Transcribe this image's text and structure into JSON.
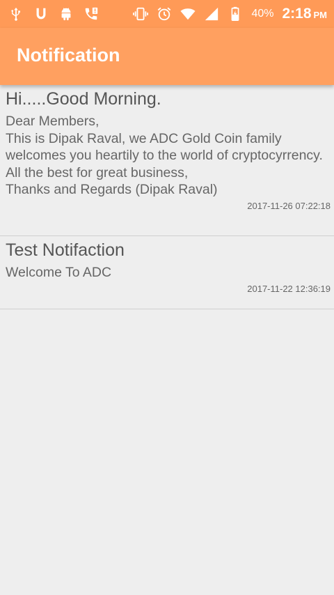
{
  "status_bar": {
    "icons_left": [
      "usb-icon",
      "u-app-icon",
      "android-icon",
      "missed-call-icon"
    ],
    "icons_right": [
      "vibrate-icon",
      "alarm-icon",
      "wifi-icon",
      "cell-signal-icon",
      "battery-charging-icon"
    ],
    "battery": "40%",
    "time": "2:18",
    "ampm": "PM"
  },
  "appbar": {
    "title": "Notification"
  },
  "notifications": [
    {
      "title": "Hi.....Good Morning.",
      "body": "Dear Members,\nThis is Dipak Raval, we ADC Gold Coin family welcomes you heartily to the world of cryptocyrrency.\nAll the best for great business,\nThanks and Regards (Dipak Raval)",
      "date": "2017-11-26 07:22:18"
    },
    {
      "title": "Test Notifaction",
      "body": "Welcome To ADC",
      "date": "2017-11-22 12:36:19"
    }
  ],
  "colors": {
    "status_bar": "#ff9a57",
    "app_bar": "#ffa060",
    "background": "#eeeeee"
  }
}
